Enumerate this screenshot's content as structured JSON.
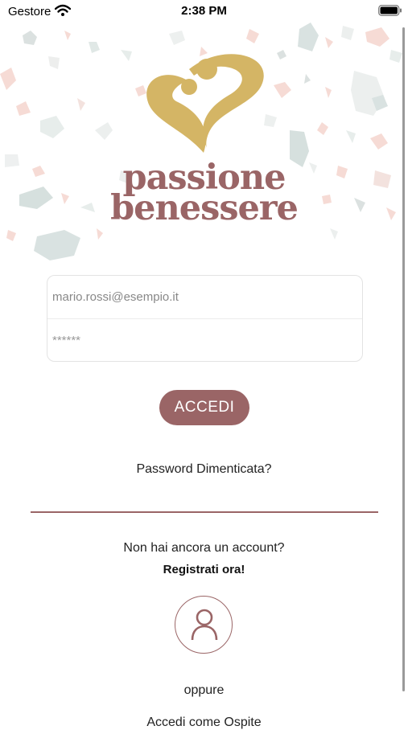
{
  "status_bar": {
    "carrier": "Gestore",
    "time": "2:38 PM"
  },
  "brand": {
    "line1": "passione",
    "line2": "benessere"
  },
  "login": {
    "email_value": "mario.rossi@esempio.it",
    "password_placeholder": "******",
    "submit_label": "ACCEDI"
  },
  "links": {
    "forgot_password": "Password Dimenticata?",
    "no_account": "Non hai ancora un account?",
    "register": "Registrati ora!",
    "or": "oppure",
    "bottom_partial": "Accedi come Ospite"
  },
  "colors": {
    "accent": "#9a6566",
    "gold": "#d4b565"
  }
}
